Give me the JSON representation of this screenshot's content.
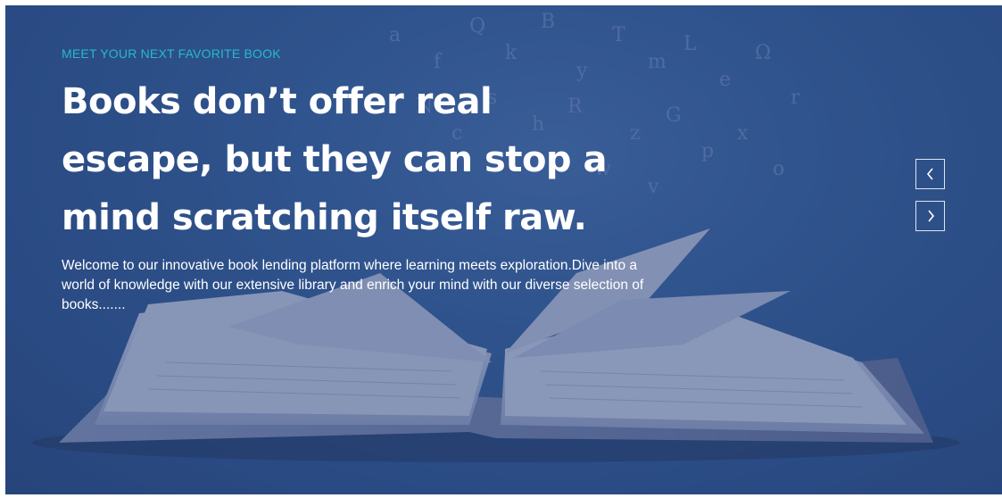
{
  "hero": {
    "eyebrow": "MEET YOUR NEXT FAVORITE BOOK",
    "headline_lines": [
      "Books don’t offer real",
      "escape, but they can stop a",
      "mind scratching itself raw."
    ],
    "intro_lines": [
      "Welcome to our innovative book lending platform where learning meets exploration.Dive into a",
      "world of knowledge with our extensive library and enrich your mind with our diverse selection of",
      "books......."
    ],
    "background_image": "open-book-flying-letters"
  },
  "carousel": {
    "prev_icon": "chevron-left-icon",
    "next_icon": "chevron-right-icon"
  },
  "colors": {
    "accent": "#27b9cc",
    "background": "#2f5b98",
    "text": "#ffffff"
  }
}
